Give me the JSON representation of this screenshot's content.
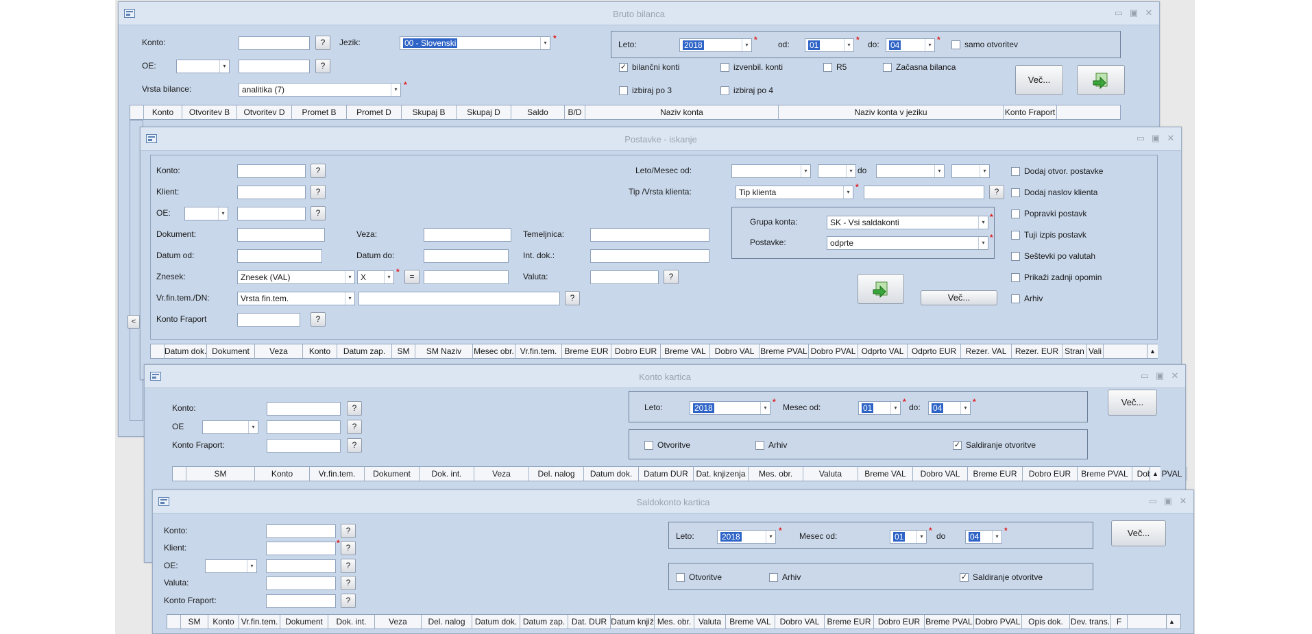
{
  "bruto": {
    "title": "Bruto bilanca",
    "konto": "Konto:",
    "jezik": "Jezik:",
    "jezik_value": "00 - Slovenski",
    "oe": "OE:",
    "vrsta": "Vrsta bilance:",
    "vrsta_value": "analitika (7)",
    "leto": "Leto:",
    "leto_value": "2018",
    "od": "od:",
    "od_value": "01",
    "do": "do:",
    "do_value": "04",
    "samo": "samo otvoritev",
    "bilancni": "bilančni konti",
    "izvenbil": "izvenbil. konti",
    "r5": "R5",
    "zacasna": "Začasna bilanca",
    "izbiraj3": "izbiraj po 3",
    "izbiraj4": "izbiraj po 4",
    "vec": "Več...",
    "columns": [
      "Konto",
      "Otvoritev B",
      "Otvoritev D",
      "Promet B",
      "Promet D",
      "Skupaj B",
      "Skupaj D",
      "Saldo",
      "B/D",
      "Naziv konta",
      "Naziv konta v jeziku",
      "Konto Fraport"
    ]
  },
  "postavke": {
    "title": "Postavke - iskanje",
    "konto": "Konto:",
    "klient": "Klient:",
    "oe": "OE:",
    "dokument": "Dokument:",
    "veza": "Veza:",
    "temeljnica": "Temeljnica:",
    "datum_od": "Datum od:",
    "datum_do": "Datum do:",
    "int_dok": "Int. dok.:",
    "znesek": "Znesek:",
    "znesek_value": "Znesek (VAL)",
    "x_value": "X",
    "eq": "=",
    "valuta": "Valuta:",
    "vrfin": "Vr.fin.tem./DN:",
    "vrfin_value": "Vrsta fin.tem.",
    "konto_fraport": "Konto Fraport",
    "leto_mesec": "Leto/Mesec od:",
    "do_word": "do",
    "tip": "Tip /Vrsta klienta:",
    "tip_value": "Tip klienta",
    "grupa": "Grupa konta:",
    "grupa_value": "SK - Vsi saldakonti",
    "postavke": "Postavke:",
    "postavke_value": "odprte",
    "vec": "Več...",
    "chk": [
      "Dodaj otvor. postavke",
      "Dodaj naslov klienta",
      "Popravki postavk",
      "Tuji izpis postavk",
      "Seštevki po valutah",
      "Prikaži zadnji opomin",
      "Arhiv"
    ],
    "columns": [
      "Datum dok.",
      "Dokument",
      "Veza",
      "Konto",
      "Datum zap.",
      "SM",
      "SM Naziv",
      "Mesec obr.",
      "Vr.fin.tem.",
      "Breme EUR",
      "Dobro EUR",
      "Breme VAL",
      "Dobro VAL",
      "Breme PVAL",
      "Dobro PVAL",
      "Odprto VAL",
      "Odprto EUR",
      "Rezer. VAL",
      "Rezer. EUR",
      "Stran",
      "Vali"
    ]
  },
  "konto": {
    "title": "Konto kartica",
    "konto": "Konto:",
    "oe": "OE",
    "konto_fraport": "Konto Fraport:",
    "leto": "Leto:",
    "leto_value": "2018",
    "mesec_od": "Mesec od:",
    "mesec_value": "01",
    "do": "do:",
    "do_value": "04",
    "vec": "Več...",
    "otvoritve": "Otvoritve",
    "arhiv": "Arhiv",
    "saldiranje": "Saldiranje otvoritve",
    "columns": [
      "SM",
      "Konto",
      "Vr.fin.tem.",
      "Dokument",
      "Dok. int.",
      "Veza",
      "Del. nalog",
      "Datum dok.",
      "Datum DUR",
      "Dat. knjizenja",
      "Mes. obr.",
      "Valuta",
      "Breme VAL",
      "Dobro VAL",
      "Breme EUR",
      "Dobro EUR",
      "Breme PVAL",
      "Dobro PVAL"
    ]
  },
  "saldo": {
    "title": "Saldokonto kartica",
    "konto": "Konto:",
    "klient": "Klient:",
    "oe": "OE:",
    "valuta": "Valuta:",
    "konto_fraport": "Konto Fraport:",
    "leto": "Leto:",
    "leto_value": "2018",
    "mesec_od": "Mesec od:",
    "mesec_value": "01",
    "do": "do",
    "do_value": "04",
    "vec": "Več...",
    "otvoritve": "Otvoritve",
    "arhiv": "Arhiv",
    "saldiranje": "Saldiranje otvoritve",
    "columns": [
      "SM",
      "Konto",
      "Vr.fin.tem.",
      "Dokument",
      "Dok. int.",
      "Veza",
      "Del. nalog",
      "Datum dok.",
      "Datum zap.",
      "Dat. DUR",
      "Datum knjiž",
      "Mes. obr.",
      "Valuta",
      "Breme VAL",
      "Dobro VAL",
      "Breme EUR",
      "Dobro EUR",
      "Breme PVAL",
      "Dobro PVAL",
      "Opis dok.",
      "Dev. trans.",
      "F"
    ]
  },
  "common": {
    "q": "?",
    "arrow": "▾",
    "check": "✓",
    "scroll_up": "▲",
    "left": "<",
    "minimize": "▭",
    "restore": "▣",
    "close": "✕"
  }
}
